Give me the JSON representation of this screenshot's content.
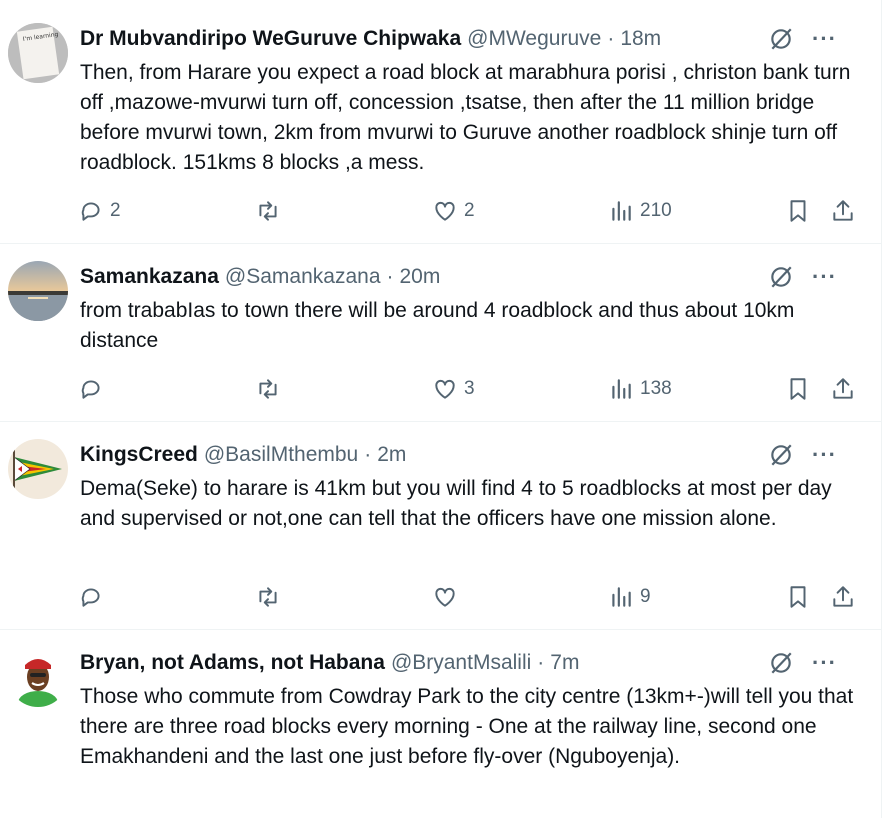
{
  "tweets": [
    {
      "name": "Dr Mubvandiripo WeGuruve Chipwaka",
      "handle": "@MWeguruve",
      "time": "18m",
      "text": "Then, from Harare you expect a road block at marabhura porisi , christon bank turn off ,mazowe-mvurwi turn off, concession ,tsatse, then after the 11 million bridge before mvurwi town, 2km from mvurwi to Guruve another roadblock shinje turn off roadblock. 151kms 8 blocks ,a mess.",
      "replies": "2",
      "retweets": "",
      "likes": "2",
      "views": "210",
      "avatar_text": "I'm learning to treat myself like someone I love"
    },
    {
      "name": "Samankazana",
      "handle": "@Samankazana",
      "time": "20m",
      "text": "from trababIas to town there will be around  4 roadblock and  thus about 10km distance",
      "replies": "",
      "retweets": "",
      "likes": "3",
      "views": "138"
    },
    {
      "name": "KingsCreed",
      "handle": "@BasilMthembu",
      "time": "2m",
      "text": "Dema(Seke) to harare is 41km but you will find 4 to 5 roadblocks at most per day and supervised or not,one can tell that the officers have one mission alone.",
      "replies": "",
      "retweets": "",
      "likes": "",
      "views": "9"
    },
    {
      "name": "Bryan, not Adams, not Habana",
      "handle": "@BryantMsalili",
      "time": "7m",
      "text": "Those who commute from Cowdray Park to the city centre (13km+-)will tell you that there are three road blocks every morning - One at the railway line, second one Emakhandeni and the last one just before fly-over (Nguboyenja).",
      "replies": "",
      "retweets": "",
      "likes": "",
      "views": ""
    }
  ],
  "icons": {
    "reply": "reply-icon",
    "retweet": "retweet-icon",
    "like": "heart-icon",
    "views": "views-icon",
    "bookmark": "bookmark-icon",
    "share": "share-icon",
    "grok": "grok-icon",
    "more": "more-icon"
  },
  "colors": {
    "text": "#0f1419",
    "secondary": "#536471",
    "divider": "#eff3f4"
  }
}
